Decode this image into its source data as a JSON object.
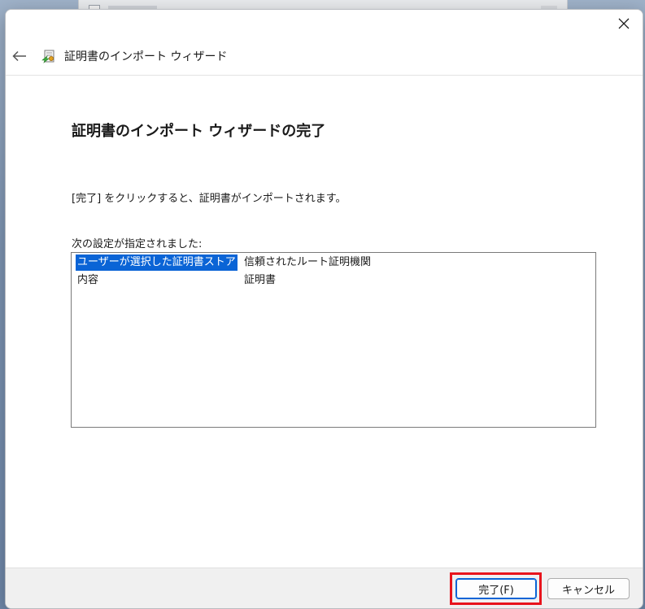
{
  "window": {
    "nav_title": "証明書のインポート ウィザード"
  },
  "page": {
    "title": "証明書のインポート ウィザードの完了",
    "instruction": "[完了] をクリックすると、証明書がインポートされます。",
    "settings_label": "次の設定が指定されました:"
  },
  "settings": {
    "rows": [
      {
        "key": "ユーザーが選択した証明書ストア",
        "value": "信頼されたルート証明機関",
        "selected": true
      },
      {
        "key": "内容",
        "value": "証明書",
        "selected": false
      }
    ]
  },
  "footer": {
    "finish_label": "完了(F)",
    "cancel_label": "キャンセル"
  },
  "colors": {
    "selection": "#0a64d6",
    "highlight": "#e8141c"
  },
  "icons": {
    "close": "close-icon",
    "back": "back-arrow-icon",
    "wizard": "certificate-icon"
  }
}
